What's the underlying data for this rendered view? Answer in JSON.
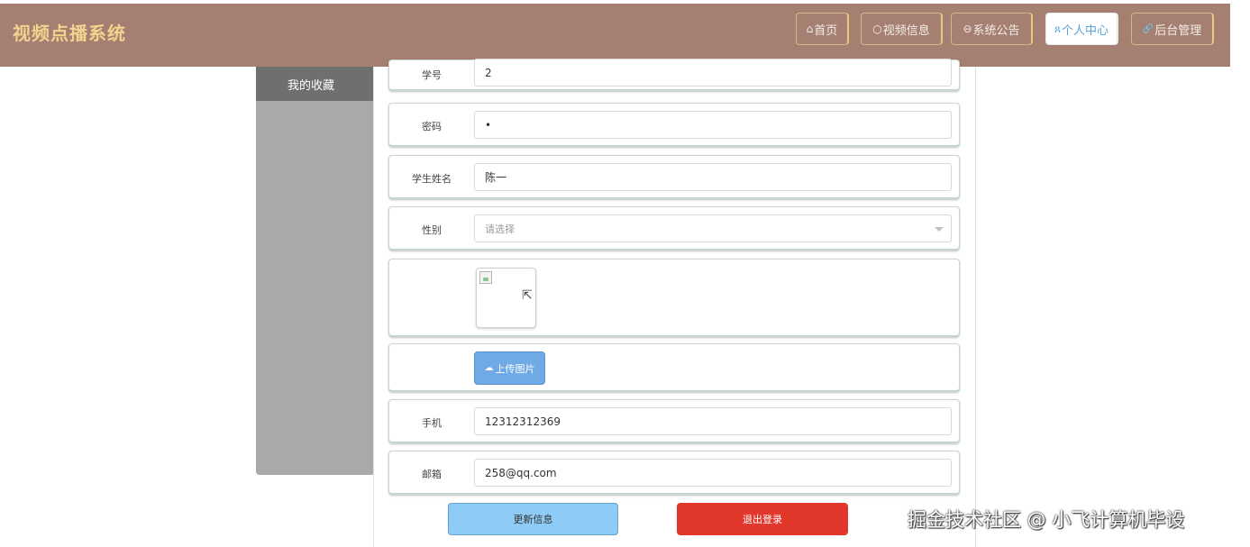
{
  "app": {
    "title": "视频点播系统"
  },
  "nav": {
    "items": [
      {
        "icon": "home-icon",
        "glyph": "⌂",
        "label": "首页"
      },
      {
        "icon": "video-icon",
        "glyph": "○",
        "label": "视频信息"
      },
      {
        "icon": "announcement-icon",
        "glyph": "⊖",
        "label": "系统公告"
      },
      {
        "icon": "user-icon",
        "glyph": "ጸ",
        "label": "个人中心",
        "active": true
      },
      {
        "icon": "link-icon",
        "glyph": "🔗",
        "label": "后台管理"
      }
    ]
  },
  "sidebar": {
    "items": [
      {
        "label": "我的收藏"
      }
    ]
  },
  "form": {
    "student_id": {
      "label": "学号",
      "value": "2"
    },
    "password": {
      "label": "密码",
      "value": "•"
    },
    "name": {
      "label": "学生姓名",
      "value": "陈一"
    },
    "gender": {
      "label": "性别",
      "placeholder": "请选择"
    },
    "upload": {
      "label": "上传图片",
      "icon": "cloud-upload-icon"
    },
    "phone": {
      "label": "手机",
      "value": "12312312369"
    },
    "email": {
      "label": "邮箱",
      "value": "258@qq.com"
    }
  },
  "actions": {
    "update": "更新信息",
    "logout": "退出登录"
  },
  "watermark": "掘金技术社区 @ 小飞计算机毕设",
  "colors": {
    "topbar": "#a57f72",
    "brand": "#f2d38e",
    "active_nav_text": "#5aa3d8",
    "sidebar": "#a9a9aa",
    "sidebar_item": "#6f6f6f",
    "upload_button": "#6fa9e6",
    "update_button": "#8ecbf5",
    "logout_button": "#e2382c"
  }
}
